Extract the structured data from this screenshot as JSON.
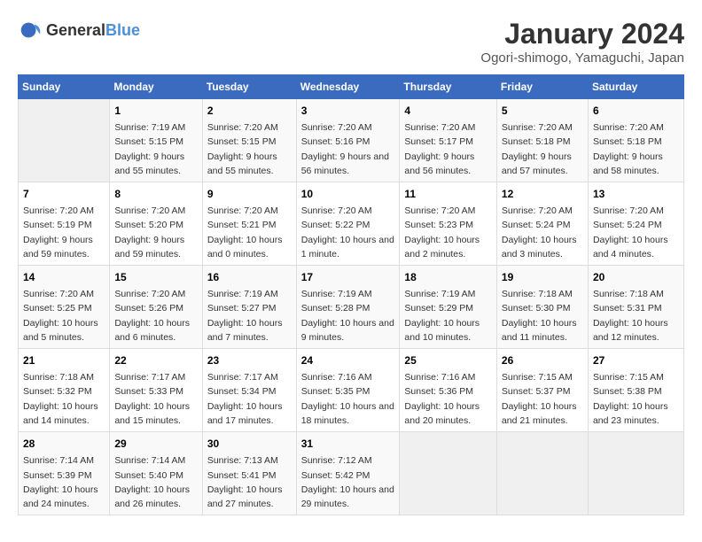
{
  "header": {
    "logo_general": "General",
    "logo_blue": "Blue",
    "title": "January 2024",
    "subtitle": "Ogori-shimogo, Yamaguchi, Japan"
  },
  "days_of_week": [
    "Sunday",
    "Monday",
    "Tuesday",
    "Wednesday",
    "Thursday",
    "Friday",
    "Saturday"
  ],
  "weeks": [
    [
      {
        "day": "",
        "sunrise": "",
        "sunset": "",
        "daylight": "",
        "empty": true
      },
      {
        "day": "1",
        "sunrise": "Sunrise: 7:19 AM",
        "sunset": "Sunset: 5:15 PM",
        "daylight": "Daylight: 9 hours and 55 minutes."
      },
      {
        "day": "2",
        "sunrise": "Sunrise: 7:20 AM",
        "sunset": "Sunset: 5:15 PM",
        "daylight": "Daylight: 9 hours and 55 minutes."
      },
      {
        "day": "3",
        "sunrise": "Sunrise: 7:20 AM",
        "sunset": "Sunset: 5:16 PM",
        "daylight": "Daylight: 9 hours and 56 minutes."
      },
      {
        "day": "4",
        "sunrise": "Sunrise: 7:20 AM",
        "sunset": "Sunset: 5:17 PM",
        "daylight": "Daylight: 9 hours and 56 minutes."
      },
      {
        "day": "5",
        "sunrise": "Sunrise: 7:20 AM",
        "sunset": "Sunset: 5:18 PM",
        "daylight": "Daylight: 9 hours and 57 minutes."
      },
      {
        "day": "6",
        "sunrise": "Sunrise: 7:20 AM",
        "sunset": "Sunset: 5:18 PM",
        "daylight": "Daylight: 9 hours and 58 minutes."
      }
    ],
    [
      {
        "day": "7",
        "sunrise": "Sunrise: 7:20 AM",
        "sunset": "Sunset: 5:19 PM",
        "daylight": "Daylight: 9 hours and 59 minutes."
      },
      {
        "day": "8",
        "sunrise": "Sunrise: 7:20 AM",
        "sunset": "Sunset: 5:20 PM",
        "daylight": "Daylight: 9 hours and 59 minutes."
      },
      {
        "day": "9",
        "sunrise": "Sunrise: 7:20 AM",
        "sunset": "Sunset: 5:21 PM",
        "daylight": "Daylight: 10 hours and 0 minutes."
      },
      {
        "day": "10",
        "sunrise": "Sunrise: 7:20 AM",
        "sunset": "Sunset: 5:22 PM",
        "daylight": "Daylight: 10 hours and 1 minute."
      },
      {
        "day": "11",
        "sunrise": "Sunrise: 7:20 AM",
        "sunset": "Sunset: 5:23 PM",
        "daylight": "Daylight: 10 hours and 2 minutes."
      },
      {
        "day": "12",
        "sunrise": "Sunrise: 7:20 AM",
        "sunset": "Sunset: 5:24 PM",
        "daylight": "Daylight: 10 hours and 3 minutes."
      },
      {
        "day": "13",
        "sunrise": "Sunrise: 7:20 AM",
        "sunset": "Sunset: 5:24 PM",
        "daylight": "Daylight: 10 hours and 4 minutes."
      }
    ],
    [
      {
        "day": "14",
        "sunrise": "Sunrise: 7:20 AM",
        "sunset": "Sunset: 5:25 PM",
        "daylight": "Daylight: 10 hours and 5 minutes."
      },
      {
        "day": "15",
        "sunrise": "Sunrise: 7:20 AM",
        "sunset": "Sunset: 5:26 PM",
        "daylight": "Daylight: 10 hours and 6 minutes."
      },
      {
        "day": "16",
        "sunrise": "Sunrise: 7:19 AM",
        "sunset": "Sunset: 5:27 PM",
        "daylight": "Daylight: 10 hours and 7 minutes."
      },
      {
        "day": "17",
        "sunrise": "Sunrise: 7:19 AM",
        "sunset": "Sunset: 5:28 PM",
        "daylight": "Daylight: 10 hours and 9 minutes."
      },
      {
        "day": "18",
        "sunrise": "Sunrise: 7:19 AM",
        "sunset": "Sunset: 5:29 PM",
        "daylight": "Daylight: 10 hours and 10 minutes."
      },
      {
        "day": "19",
        "sunrise": "Sunrise: 7:18 AM",
        "sunset": "Sunset: 5:30 PM",
        "daylight": "Daylight: 10 hours and 11 minutes."
      },
      {
        "day": "20",
        "sunrise": "Sunrise: 7:18 AM",
        "sunset": "Sunset: 5:31 PM",
        "daylight": "Daylight: 10 hours and 12 minutes."
      }
    ],
    [
      {
        "day": "21",
        "sunrise": "Sunrise: 7:18 AM",
        "sunset": "Sunset: 5:32 PM",
        "daylight": "Daylight: 10 hours and 14 minutes."
      },
      {
        "day": "22",
        "sunrise": "Sunrise: 7:17 AM",
        "sunset": "Sunset: 5:33 PM",
        "daylight": "Daylight: 10 hours and 15 minutes."
      },
      {
        "day": "23",
        "sunrise": "Sunrise: 7:17 AM",
        "sunset": "Sunset: 5:34 PM",
        "daylight": "Daylight: 10 hours and 17 minutes."
      },
      {
        "day": "24",
        "sunrise": "Sunrise: 7:16 AM",
        "sunset": "Sunset: 5:35 PM",
        "daylight": "Daylight: 10 hours and 18 minutes."
      },
      {
        "day": "25",
        "sunrise": "Sunrise: 7:16 AM",
        "sunset": "Sunset: 5:36 PM",
        "daylight": "Daylight: 10 hours and 20 minutes."
      },
      {
        "day": "26",
        "sunrise": "Sunrise: 7:15 AM",
        "sunset": "Sunset: 5:37 PM",
        "daylight": "Daylight: 10 hours and 21 minutes."
      },
      {
        "day": "27",
        "sunrise": "Sunrise: 7:15 AM",
        "sunset": "Sunset: 5:38 PM",
        "daylight": "Daylight: 10 hours and 23 minutes."
      }
    ],
    [
      {
        "day": "28",
        "sunrise": "Sunrise: 7:14 AM",
        "sunset": "Sunset: 5:39 PM",
        "daylight": "Daylight: 10 hours and 24 minutes."
      },
      {
        "day": "29",
        "sunrise": "Sunrise: 7:14 AM",
        "sunset": "Sunset: 5:40 PM",
        "daylight": "Daylight: 10 hours and 26 minutes."
      },
      {
        "day": "30",
        "sunrise": "Sunrise: 7:13 AM",
        "sunset": "Sunset: 5:41 PM",
        "daylight": "Daylight: 10 hours and 27 minutes."
      },
      {
        "day": "31",
        "sunrise": "Sunrise: 7:12 AM",
        "sunset": "Sunset: 5:42 PM",
        "daylight": "Daylight: 10 hours and 29 minutes."
      },
      {
        "day": "",
        "sunrise": "",
        "sunset": "",
        "daylight": "",
        "empty": true
      },
      {
        "day": "",
        "sunrise": "",
        "sunset": "",
        "daylight": "",
        "empty": true
      },
      {
        "day": "",
        "sunrise": "",
        "sunset": "",
        "daylight": "",
        "empty": true
      }
    ]
  ]
}
